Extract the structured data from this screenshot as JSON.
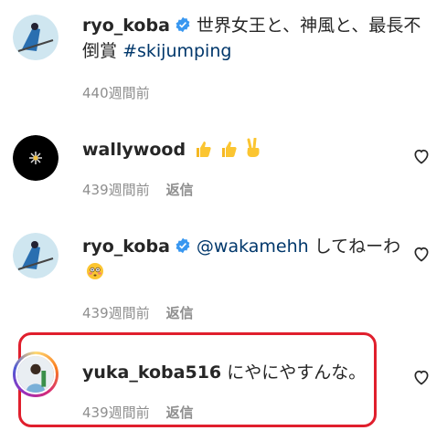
{
  "comments": [
    {
      "username": "ryo_koba",
      "verified": true,
      "text": "世界女王と、神風と、最長不倒賞",
      "hashtag": "#skijumping",
      "time": "440週間前",
      "reply": ""
    },
    {
      "username": "wallywood",
      "verified": false,
      "emojis": [
        "thumbs-up",
        "thumbs-up",
        "victory-hand"
      ],
      "time": "439週間前",
      "reply": "返信"
    },
    {
      "username": "ryo_koba",
      "verified": true,
      "mention": "@wakamehh",
      "text": "してねーわ",
      "emojis": [
        "flushed-face"
      ],
      "time": "439週間前",
      "reply": "返信"
    },
    {
      "username": "yuka_koba516",
      "verified": false,
      "text": "にやにやすんな。",
      "time": "439週間前",
      "reply": "返信"
    }
  ],
  "colors": {
    "verified_blue": "#3897f0",
    "hashtag": "#00376b",
    "meta_gray": "#8e8e8e",
    "highlight_red": "#e01f2d"
  }
}
